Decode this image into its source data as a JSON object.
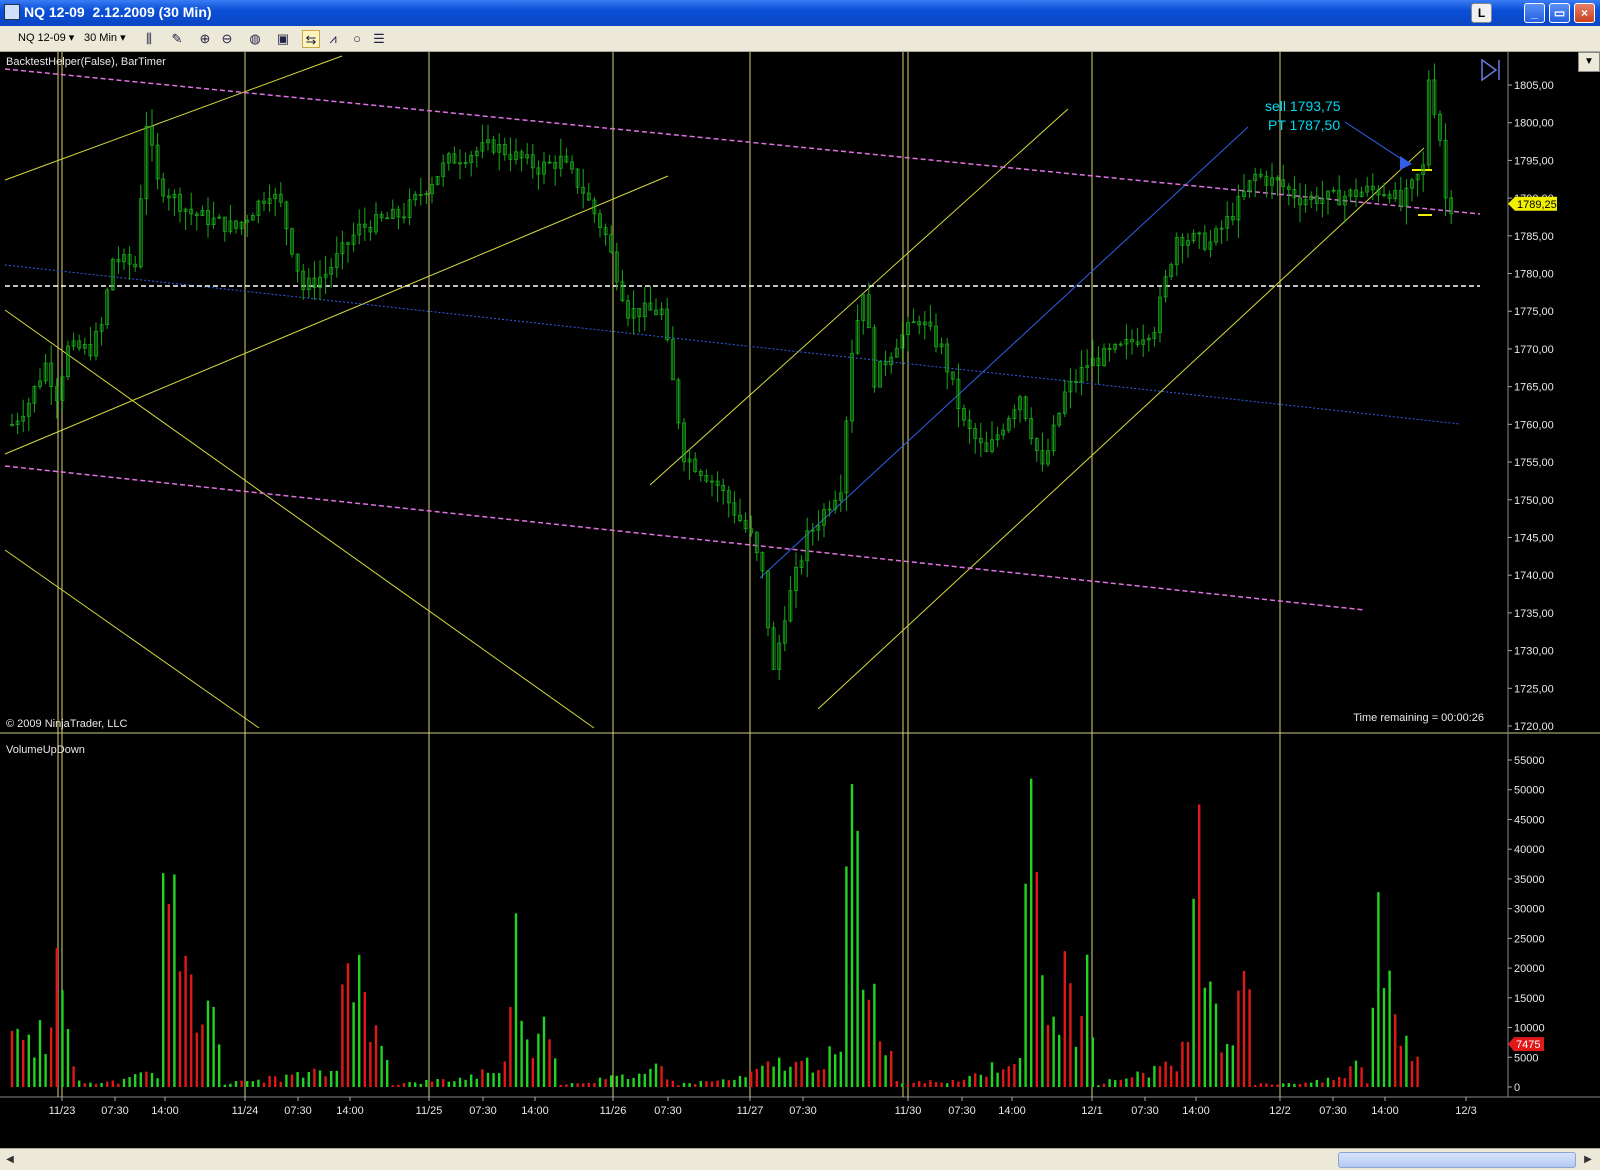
{
  "window": {
    "title": "NQ 12-09  2.12.2009 (30 Min)",
    "btn_l": "L",
    "btn_min": "_",
    "btn_max": "▭",
    "btn_close": "×"
  },
  "toolbar": {
    "instrument": "NQ 12-09",
    "interval": "30 Min",
    "dropdown_arrow": "▾"
  },
  "colors": {
    "background": "#000000",
    "candle": "#1aa81a",
    "vol_up": "#22d422",
    "vol_down": "#e01818",
    "yellow": "#d8d840",
    "magenta": "#e070e0",
    "blue": "#3060e8",
    "text": "#e8e8e8",
    "annotation": "#00d8f0",
    "price_marker": "#f0f000"
  },
  "price_panel": {
    "indicator_label": "BacktestHelper(False), BarTimer",
    "copyright": "© 2009 NinjaTrader, LLC",
    "timer_text": "Time remaining = 00:00:26",
    "last_price": "1789,25",
    "annotation_sell": "sell 1793,75",
    "annotation_pt": "PT 1787,50",
    "ylim": [
      1720,
      1805
    ],
    "y_ticks": [
      "1805,00",
      "1800,00",
      "1795,00",
      "1790,00",
      "1785,00",
      "1780,00",
      "1775,00",
      "1770,00",
      "1765,00",
      "1760,00",
      "1755,00",
      "1750,00",
      "1745,00",
      "1740,00",
      "1735,00",
      "1730,00",
      "1725,00",
      "1720,00"
    ]
  },
  "volume_panel": {
    "indicator_label": "VolumeUpDown",
    "last_volume": "7475",
    "ylim": [
      0,
      57000
    ],
    "y_ticks": [
      "55000",
      "50000",
      "45000",
      "40000",
      "35000",
      "30000",
      "25000",
      "20000",
      "15000",
      "10000",
      "5000",
      "0"
    ]
  },
  "x_axis": {
    "ticks": [
      "11/23",
      "07:30",
      "14:00",
      "11/24",
      "07:30",
      "14:00",
      "11/25",
      "07:30",
      "14:00",
      "11/26",
      "07:30",
      "11/27",
      "07:30",
      "11/30",
      "07:30",
      "14:00",
      "12/1",
      "07:30",
      "14:00",
      "12/2",
      "07:30",
      "14:00",
      "12/3"
    ]
  },
  "chart_data": {
    "type": "candlestick",
    "price_anchors": [
      [
        0,
        1760
      ],
      [
        3,
        1763
      ],
      [
        6,
        1768
      ],
      [
        8,
        1764
      ],
      [
        10,
        1770
      ],
      [
        14,
        1770
      ],
      [
        16,
        1773
      ],
      [
        18,
        1782
      ],
      [
        22,
        1781
      ],
      [
        24,
        1800
      ],
      [
        26,
        1792
      ],
      [
        32,
        1788
      ],
      [
        40,
        1786
      ],
      [
        46,
        1791
      ],
      [
        48,
        1789
      ],
      [
        52,
        1778
      ],
      [
        56,
        1780
      ],
      [
        62,
        1786
      ],
      [
        70,
        1788
      ],
      [
        78,
        1795
      ],
      [
        86,
        1797
      ],
      [
        94,
        1794
      ],
      [
        98,
        1795
      ],
      [
        102,
        1791
      ],
      [
        106,
        1785
      ],
      [
        110,
        1775
      ],
      [
        116,
        1775
      ],
      [
        120,
        1756
      ],
      [
        126,
        1752
      ],
      [
        132,
        1745
      ],
      [
        134,
        1740
      ],
      [
        136,
        1727
      ],
      [
        138,
        1735
      ],
      [
        142,
        1745
      ],
      [
        148,
        1752
      ],
      [
        150,
        1770
      ],
      [
        152,
        1778
      ],
      [
        154,
        1766
      ],
      [
        158,
        1771
      ],
      [
        162,
        1774
      ],
      [
        166,
        1770
      ],
      [
        170,
        1760
      ],
      [
        174,
        1756
      ],
      [
        180,
        1764
      ],
      [
        184,
        1754
      ],
      [
        188,
        1764
      ],
      [
        192,
        1768
      ],
      [
        198,
        1770
      ],
      [
        204,
        1773
      ],
      [
        208,
        1785
      ],
      [
        214,
        1784
      ],
      [
        218,
        1788
      ],
      [
        222,
        1793
      ],
      [
        226,
        1792
      ],
      [
        230,
        1790
      ],
      [
        236,
        1790
      ],
      [
        242,
        1791
      ],
      [
        246,
        1791
      ],
      [
        248,
        1789
      ],
      [
        252,
        1794
      ],
      [
        253,
        1806
      ],
      [
        255,
        1798
      ],
      [
        256,
        1790
      ],
      [
        257,
        1789
      ]
    ],
    "volume_anchors": [
      [
        0,
        14000
      ],
      [
        2,
        9000
      ],
      [
        4,
        9000
      ],
      [
        6,
        11000
      ],
      [
        8,
        23000
      ],
      [
        10,
        8000
      ],
      [
        12,
        500
      ],
      [
        20,
        1200
      ],
      [
        26,
        3000
      ],
      [
        28,
        57000
      ],
      [
        30,
        20000
      ],
      [
        34,
        12000
      ],
      [
        36,
        27000
      ],
      [
        38,
        600
      ],
      [
        58,
        3000
      ],
      [
        60,
        38000
      ],
      [
        62,
        20000
      ],
      [
        64,
        9000
      ],
      [
        66,
        13000
      ],
      [
        68,
        500
      ],
      [
        80,
        1500
      ],
      [
        88,
        4000
      ],
      [
        90,
        26000
      ],
      [
        92,
        12000
      ],
      [
        94,
        8000
      ],
      [
        96,
        15000
      ],
      [
        98,
        500
      ],
      [
        110,
        2000
      ],
      [
        116,
        4000
      ],
      [
        118,
        500
      ],
      [
        130,
        1500
      ],
      [
        138,
        5000
      ],
      [
        140,
        4000
      ],
      [
        148,
        6000
      ],
      [
        150,
        56000
      ],
      [
        152,
        26000
      ],
      [
        154,
        17000
      ],
      [
        156,
        10000
      ],
      [
        158,
        500
      ],
      [
        170,
        1500
      ],
      [
        176,
        4000
      ],
      [
        180,
        7000
      ],
      [
        182,
        49000
      ],
      [
        184,
        22000
      ],
      [
        186,
        11000
      ],
      [
        188,
        20000
      ],
      [
        190,
        11000
      ],
      [
        192,
        34000
      ],
      [
        194,
        500
      ],
      [
        204,
        3500
      ],
      [
        208,
        3500
      ],
      [
        210,
        15000
      ],
      [
        212,
        43000
      ],
      [
        214,
        24000
      ],
      [
        216,
        12000
      ],
      [
        218,
        8000
      ],
      [
        220,
        37000
      ],
      [
        222,
        500
      ],
      [
        234,
        1000
      ],
      [
        238,
        2000
      ],
      [
        240,
        5000
      ],
      [
        242,
        1000
      ],
      [
        244,
        32000
      ],
      [
        246,
        20000
      ],
      [
        248,
        12000
      ],
      [
        250,
        7475
      ]
    ],
    "total_bars": 258
  }
}
